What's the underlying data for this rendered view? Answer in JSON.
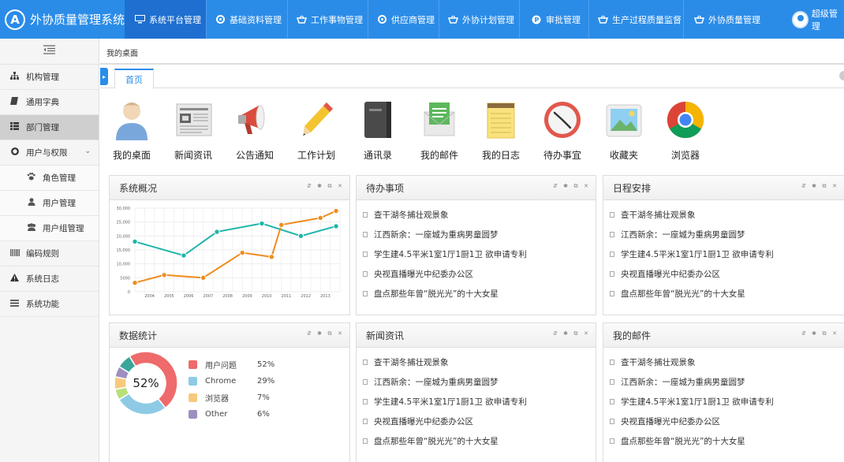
{
  "header": {
    "app_title": "外协质量管理系统",
    "logo_letter": "A",
    "nav": [
      {
        "label": "系统平台管理",
        "icon": "monitor-icon",
        "active": true
      },
      {
        "label": "基础资料管理",
        "icon": "circle-dot-icon"
      },
      {
        "label": "工作事物管理",
        "icon": "basket-icon"
      },
      {
        "label": "供应商管理",
        "icon": "circle-dot-icon"
      },
      {
        "label": "外协计划管理",
        "icon": "basket-icon"
      },
      {
        "label": "审批管理",
        "icon": "p-badge-icon"
      },
      {
        "label": "生产过程质量监督",
        "icon": "basket-icon"
      },
      {
        "label": "外协质量管理",
        "icon": "basket-icon"
      }
    ],
    "user_label": "超级管理"
  },
  "sidebar": {
    "toggle_icon": "indent-icon",
    "items": [
      {
        "label": "机构管理",
        "icon": "sitemap-icon"
      },
      {
        "label": "通用字典",
        "icon": "book-icon"
      },
      {
        "label": "部门管理",
        "icon": "list-icon",
        "active": true
      },
      {
        "label": "用户与权限",
        "icon": "circle-icon",
        "expanded": true
      },
      {
        "label": "角色管理",
        "icon": "paw-icon",
        "sub": true
      },
      {
        "label": "用户管理",
        "icon": "user-icon",
        "sub": true
      },
      {
        "label": "用户组管理",
        "icon": "users-icon",
        "sub": true
      },
      {
        "label": "编码规则",
        "icon": "barcode-icon"
      },
      {
        "label": "系统日志",
        "icon": "warning-icon"
      },
      {
        "label": "系统功能",
        "icon": "bars-icon"
      }
    ]
  },
  "breadcrumb": "我的桌面",
  "tabs": {
    "home": "首页"
  },
  "apps": [
    {
      "label": "我的桌面",
      "icon": "person-icon"
    },
    {
      "label": "新闻资讯",
      "icon": "newspaper-icon"
    },
    {
      "label": "公告通知",
      "icon": "megaphone-icon"
    },
    {
      "label": "工作计划",
      "icon": "pencil-icon"
    },
    {
      "label": "通讯录",
      "icon": "address-book-icon"
    },
    {
      "label": "我的邮件",
      "icon": "envelope-icon"
    },
    {
      "label": "我的日志",
      "icon": "notepad-icon"
    },
    {
      "label": "待办事宜",
      "icon": "clock-icon"
    },
    {
      "label": "收藏夹",
      "icon": "picture-icon"
    },
    {
      "label": "浏览器",
      "icon": "chrome-icon"
    }
  ],
  "panels": {
    "overview": {
      "title": "系统概况"
    },
    "todo": {
      "title": "待办事项"
    },
    "schedule": {
      "title": "日程安排"
    },
    "stats": {
      "title": "数据统计"
    },
    "news": {
      "title": "新闻资讯"
    },
    "mail": {
      "title": "我的邮件"
    }
  },
  "news_items": [
    "查干湖冬捕壮观景象",
    "江西新余：一座城为重病男童圆梦",
    "学生建4.5平米1室1厅1厨1卫 欲申请专利",
    "央视直播曝光中纪委办公区",
    "盘点那些年曾“脱光光”的十大女星"
  ],
  "chart_data": {
    "type": "line",
    "x": [
      "2004",
      "2005",
      "2006",
      "2007",
      "2008",
      "2009",
      "2010",
      "2011",
      "2012",
      "2013"
    ],
    "ylim": [
      0,
      30000
    ],
    "y_ticks": [
      "30,000",
      "25,000",
      "20,000",
      "15,000",
      "10,000",
      "5000",
      "0"
    ],
    "series": [
      {
        "color": "#1fb5a8",
        "points": [
          [
            "2003.5",
            18000
          ],
          [
            "2006",
            13000
          ],
          [
            "2007.7",
            21500
          ],
          [
            "2010",
            24500
          ],
          [
            "2012",
            20000
          ],
          [
            "2013.8",
            23500
          ]
        ]
      },
      {
        "color": "#f08c1e",
        "points": [
          [
            "2003.5",
            3200
          ],
          [
            "2005",
            6000
          ],
          [
            "2007",
            5000
          ],
          [
            "2009",
            14000
          ],
          [
            "2010.5",
            12500
          ],
          [
            "2011",
            24000
          ],
          [
            "2013",
            26500
          ],
          [
            "2013.8",
            29000
          ]
        ]
      }
    ]
  },
  "donut": {
    "center_label": "52%",
    "slices": [
      {
        "name": "用户问题",
        "value": "52%",
        "color": "#ef6a6a"
      },
      {
        "name": "Chrome",
        "value": "29%",
        "color": "#8ecae6"
      },
      {
        "name": "浏览器",
        "value": "7%",
        "color": "#f7c97e"
      },
      {
        "name": "Other",
        "value": "6%",
        "color": "#9f8fc0"
      }
    ],
    "extra_colors": [
      "#b7e07a",
      "#3aa69a",
      "#9f8fc0"
    ]
  }
}
